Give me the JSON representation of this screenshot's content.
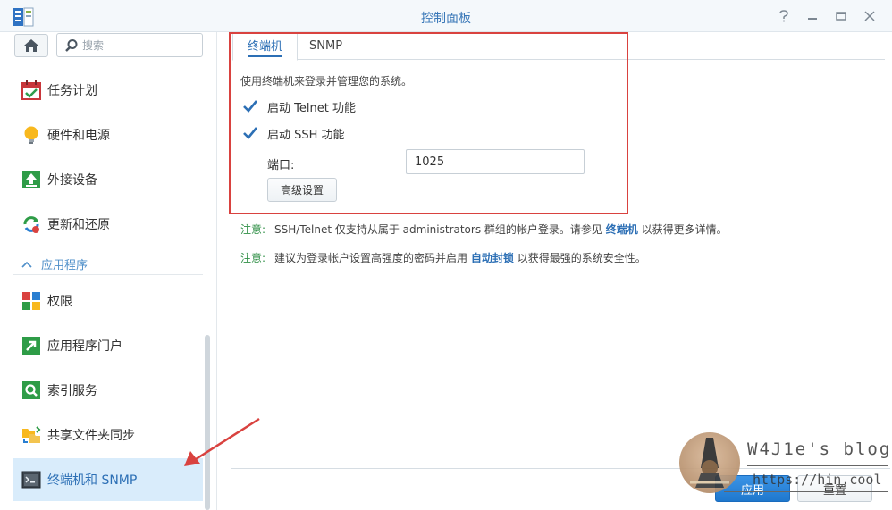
{
  "window": {
    "title": "控制面板",
    "controls": [
      "help-icon",
      "minimize-icon",
      "maximize-icon",
      "close-icon"
    ]
  },
  "sidebar": {
    "search_placeholder": "搜索",
    "items": [
      {
        "label": "任务计划",
        "icon": "calendar-icon"
      },
      {
        "label": "硬件和电源",
        "icon": "lightbulb-icon"
      },
      {
        "label": "外接设备",
        "icon": "external-device-icon"
      },
      {
        "label": "更新和还原",
        "icon": "update-restore-icon"
      }
    ],
    "section": {
      "label": "应用程序",
      "icon": "chevron-up-icon"
    },
    "app_items": [
      {
        "label": "权限",
        "icon": "privileges-icon"
      },
      {
        "label": "应用程序门户",
        "icon": "app-portal-icon"
      },
      {
        "label": "索引服务",
        "icon": "indexing-icon"
      },
      {
        "label": "共享文件夹同步",
        "icon": "folder-sync-icon"
      },
      {
        "label": "终端机和 SNMP",
        "icon": "terminal-icon",
        "active": true
      }
    ]
  },
  "main": {
    "tabs": [
      {
        "label": "终端机",
        "active": true
      },
      {
        "label": "SNMP",
        "active": false
      }
    ],
    "description": "使用终端机来登录并管理您的系统。",
    "options": [
      {
        "label": "启动 Telnet 功能",
        "checked": true
      },
      {
        "label": "启动 SSH 功能",
        "checked": true
      }
    ],
    "port": {
      "label": "端口:",
      "value": "1025"
    },
    "advanced_button": "高级设置",
    "notes": [
      {
        "key": "注意:",
        "text_before": "SSH/Telnet 仅支持从属于 administrators 群组的帐户登录。请参见",
        "link": "终端机",
        "text_after": "以获得更多详情。"
      },
      {
        "key": "注意:",
        "text_before": "建议为登录帐户设置高强度的密码并启用",
        "link": "自动封锁",
        "text_after": "以获得最强的系统安全性。"
      }
    ],
    "apply_button": "应用",
    "reset_button": "重置"
  },
  "watermark": {
    "title": "W4J1e's blog",
    "url": "https://hin.cool"
  },
  "colors": {
    "accent": "#2c6fb5",
    "highlight_box": "#d9423f",
    "note_key": "#2f8f46",
    "active_nav_bg": "#d9ecfb"
  }
}
